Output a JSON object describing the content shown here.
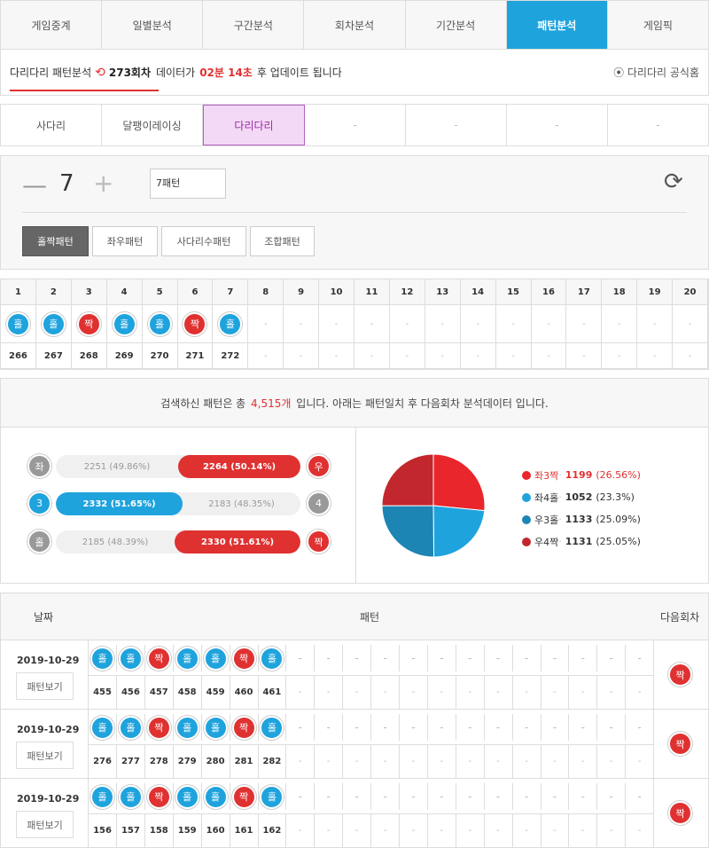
{
  "top_tabs": [
    "게임중계",
    "일별분석",
    "구간분석",
    "회차분석",
    "기간분석",
    "패턴분석",
    "게임픽"
  ],
  "top_active": 5,
  "info": {
    "title": "다리다리 패턴분석",
    "round": "273회차",
    "data_label": "데이터가",
    "timer": "02분 14초",
    "suffix": "후 업데이트 됩니다",
    "official": "다리다리 공식홈"
  },
  "game_tabs": [
    "사다리",
    "달팽이레이싱",
    "다리다리",
    "-",
    "-",
    "-",
    "-"
  ],
  "game_active": 2,
  "controls": {
    "count": "7",
    "pattern_value": "7패턴",
    "pattern_types": [
      "홀짝패턴",
      "좌우패턴",
      "사다리수패턴",
      "조합패턴"
    ]
  },
  "pattern_grid": {
    "headers": [
      "1",
      "2",
      "3",
      "4",
      "5",
      "6",
      "7",
      "8",
      "9",
      "10",
      "11",
      "12",
      "13",
      "14",
      "15",
      "16",
      "17",
      "18",
      "19",
      "20"
    ],
    "results": [
      "홀",
      "홀",
      "짝",
      "홀",
      "홀",
      "짝",
      "홀",
      "-",
      "-",
      "-",
      "-",
      "-",
      "-",
      "-",
      "-",
      "-",
      "-",
      "-",
      "-",
      "-"
    ],
    "rounds": [
      "266",
      "267",
      "268",
      "269",
      "270",
      "271",
      "272",
      "-",
      "-",
      "-",
      "-",
      "-",
      "-",
      "-",
      "-",
      "-",
      "-",
      "-",
      "-",
      "-"
    ]
  },
  "summary": {
    "prefix": "검색하신 패턴은 총",
    "count": "4,515개",
    "suffix": "입니다. 아래는 패턴일치 후 다음회차 분석데이터 입니다."
  },
  "stat_rows": [
    {
      "left_label": "좌",
      "left_text": "2251 (49.86%)",
      "right_text": "2264 (50.14%)",
      "right_label": "우",
      "winner": "right",
      "left_pct": 49.86,
      "left_color": "gray",
      "right_color": "red"
    },
    {
      "left_label": "3",
      "left_text": "2332 (51.65%)",
      "right_text": "2183 (48.35%)",
      "right_label": "4",
      "winner": "left",
      "left_pct": 51.65,
      "left_color": "blue",
      "right_color": "gray"
    },
    {
      "left_label": "홀",
      "left_text": "2185 (48.39%)",
      "right_text": "2330 (51.61%)",
      "right_label": "짝",
      "winner": "right",
      "left_pct": 48.39,
      "left_color": "gray",
      "right_color": "red"
    }
  ],
  "chart_data": {
    "type": "pie",
    "series": [
      {
        "name": "좌3짝",
        "value": 1199,
        "pct": "(26.56%)",
        "color": "#e8262c"
      },
      {
        "name": "좌4홀",
        "value": 1052,
        "pct": "(23.3%)",
        "color": "#1fa3dd"
      },
      {
        "name": "우3홀",
        "value": 1133,
        "pct": "(25.09%)",
        "color": "#1c85b3"
      },
      {
        "name": "우4짝",
        "value": 1131,
        "pct": "(25.05%)",
        "color": "#c1272d"
      }
    ]
  },
  "history": {
    "header_date": "날짜",
    "header_pattern": "패턴",
    "header_next": "다음회차",
    "view_label": "패턴보기",
    "rows": [
      {
        "date": "2019-10-29",
        "results": [
          "홀",
          "홀",
          "짝",
          "홀",
          "홀",
          "짝",
          "홀",
          "-",
          "-",
          "-",
          "-",
          "-",
          "-",
          "-",
          "-",
          "-",
          "-",
          "-",
          "-",
          "-"
        ],
        "rounds": [
          "455",
          "456",
          "457",
          "458",
          "459",
          "460",
          "461",
          "-",
          "-",
          "-",
          "-",
          "-",
          "-",
          "-",
          "-",
          "-",
          "-",
          "-",
          "-",
          "-"
        ],
        "next": "짝"
      },
      {
        "date": "2019-10-29",
        "results": [
          "홀",
          "홀",
          "짝",
          "홀",
          "홀",
          "짝",
          "홀",
          "-",
          "-",
          "-",
          "-",
          "-",
          "-",
          "-",
          "-",
          "-",
          "-",
          "-",
          "-",
          "-"
        ],
        "rounds": [
          "276",
          "277",
          "278",
          "279",
          "280",
          "281",
          "282",
          "-",
          "-",
          "-",
          "-",
          "-",
          "-",
          "-",
          "-",
          "-",
          "-",
          "-",
          "-",
          "-"
        ],
        "next": "짝"
      },
      {
        "date": "2019-10-29",
        "results": [
          "홀",
          "홀",
          "짝",
          "홀",
          "홀",
          "짝",
          "홀",
          "-",
          "-",
          "-",
          "-",
          "-",
          "-",
          "-",
          "-",
          "-",
          "-",
          "-",
          "-",
          "-"
        ],
        "rounds": [
          "156",
          "157",
          "158",
          "159",
          "160",
          "161",
          "162",
          "-",
          "-",
          "-",
          "-",
          "-",
          "-",
          "-",
          "-",
          "-",
          "-",
          "-",
          "-",
          "-"
        ],
        "next": "짝"
      }
    ]
  },
  "colors": {
    "blue": "#1fa3dd",
    "red": "#e03131",
    "accent_purple": "#9b2ba6"
  }
}
